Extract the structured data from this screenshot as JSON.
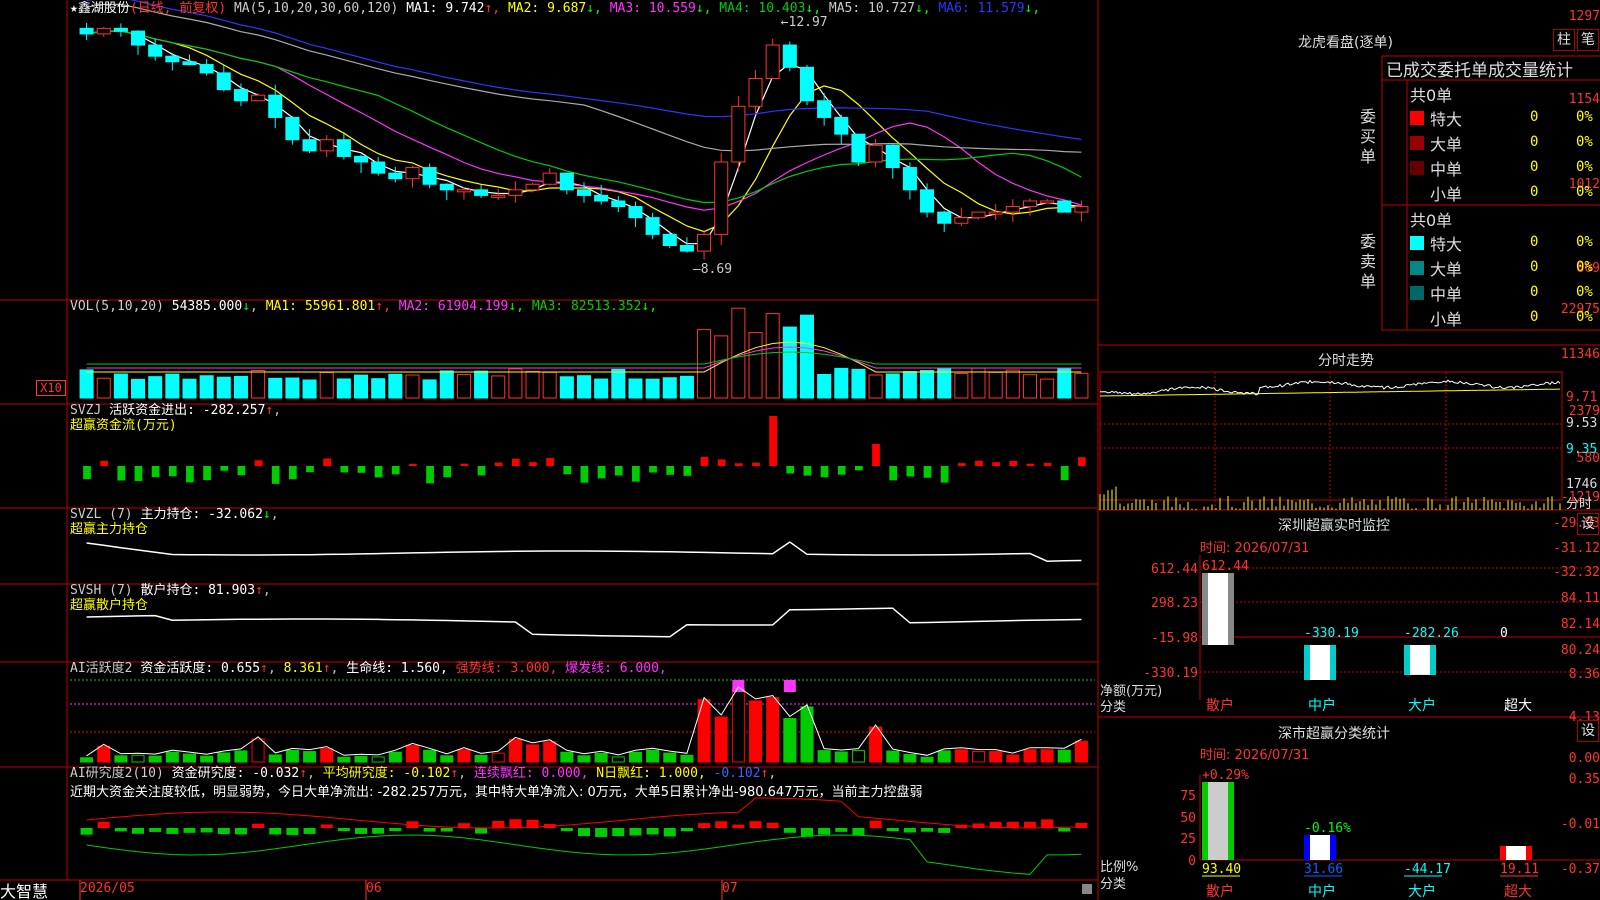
{
  "stock": {
    "name": "鑫湖股份",
    "star": "★",
    "period": "(日线, 前复权)",
    "ma_label": "MA(5,10,20,30,60,120)",
    "ma": [
      {
        "t": "MA1: 9.742",
        "a": "↑",
        "c": "#ffffff"
      },
      {
        "t": "MA2: 9.687",
        "a": "↓",
        "c": "#ffff00"
      },
      {
        "t": "MA3: 10.559",
        "a": "↓",
        "c": "#ff33ff"
      },
      {
        "t": "MA4: 10.403",
        "a": "↓",
        "c": "#00cc00"
      },
      {
        "t": "MA5: 10.727",
        "a": "↓",
        "c": "#cccccc"
      },
      {
        "t": "MA6: 11.579",
        "a": "↓",
        "c": "#3333ff"
      }
    ],
    "high_label": "12.97",
    "low_label": "8.69"
  },
  "price_axis": [
    "1297",
    "1154",
    "1012",
    "869"
  ],
  "vol": {
    "label": "VOL(5,10,20)",
    "value": "54385.000",
    "ma": [
      {
        "t": "MA1: 55961.801",
        "a": "↑",
        "c": "#ffff00"
      },
      {
        "t": "MA2: 61904.199",
        "a": "↓",
        "c": "#ff33ff"
      },
      {
        "t": "MA3: 82513.352",
        "a": "↓",
        "c": "#00cc00"
      }
    ],
    "axis": [
      "22975",
      "11346"
    ],
    "unit": "X10"
  },
  "svzj": {
    "label": "SVZJ",
    "name": "活跃资金进出: -282.257",
    "sub": "超赢资金流(万元)",
    "axis": [
      "2379",
      "580",
      "-1219"
    ]
  },
  "svzl": {
    "label": "SVZL (7)",
    "name": "主力持仓: -32.062",
    "sub": "超赢主力持仓",
    "axis": [
      "-29.93",
      "-31.12",
      "-32.32"
    ]
  },
  "svsh": {
    "label": "SVSH (7)",
    "name": "散户持仓: 81.903",
    "sub": "超赢散户持仓",
    "axis": [
      "84.11",
      "82.14",
      "80.24"
    ]
  },
  "ai1": {
    "label": "AI活跃度2",
    "a": "资金活跃度: 0.655",
    "b": "8.361",
    "c": "生命线: 1.560,",
    "d": "强势线: 3.000,",
    "e": "爆发线: 6.000,",
    "axis": [
      "8.36",
      "4.13",
      "0.00"
    ]
  },
  "ai2": {
    "label": "AI研究度2(10)",
    "a": "资金研究度: -0.032",
    "b": "平均研究度: -0.102",
    "c": "连续飘红: 0.000,",
    "d": "N日飘红: 1.000,",
    "e": "-0.102",
    "comment": "近期大资金关注度较低，明显弱势，今日大单净流出: -282.257万元，其中特大单净流入: 0万元，大单5日累计净出-980.647万元，当前主力控盘弱",
    "axis": [
      "0.35",
      "-0.01",
      "-0.37"
    ]
  },
  "date_axis": [
    "2026/05",
    "06",
    "07"
  ],
  "brand": "大智慧",
  "lhb": {
    "title": "龙虎看盘(逐单)",
    "btn1": "柱",
    "btn2": "笔",
    "tabs": [
      "已成交",
      "委托单",
      "成交量统计"
    ],
    "buy": {
      "side": "委买单",
      "total": "共0单",
      "rows": [
        {
          "n": "特大",
          "v": "0",
          "p": "0%",
          "c": "#ff0000"
        },
        {
          "n": "大单",
          "v": "0",
          "p": "0%",
          "c": "#990000"
        },
        {
          "n": "中单",
          "v": "0",
          "p": "0%",
          "c": "#660000"
        },
        {
          "n": "小单",
          "v": "0",
          "p": "0%",
          "c": "#000000"
        }
      ]
    },
    "sell": {
      "side": "委卖单",
      "total": "共0单",
      "rows": [
        {
          "n": "特大",
          "v": "0",
          "p": "0%",
          "c": "#00ffff"
        },
        {
          "n": "大单",
          "v": "0",
          "p": "0%",
          "c": "#008888"
        },
        {
          "n": "中单",
          "v": "0",
          "p": "0%",
          "c": "#006666"
        },
        {
          "n": "小单",
          "v": "0",
          "p": "0%",
          "c": "#000000"
        }
      ]
    }
  },
  "fenshi": {
    "title": "分时走势",
    "axis": [
      "9.71",
      "9.53",
      "9.35"
    ],
    "vol_axis": [
      "1746",
      "分时"
    ]
  },
  "sz_monitor": {
    "title": "深圳超赢实时监控",
    "btn": "设",
    "time": "时间: 2026/07/31",
    "axis": [
      "612.44",
      "298.23",
      "-15.98",
      "-330.19"
    ],
    "ylabel": "净额(万元)",
    "xlabel": "分类",
    "cats": [
      "散户",
      "中户",
      "大户",
      "超大"
    ],
    "vals": [
      "612.44",
      "-330.19",
      "-282.26",
      "0"
    ]
  },
  "sz_class": {
    "title": "深市超赢分类统计",
    "btn": "设",
    "time": "时间: 2026/07/31",
    "axis": [
      "75",
      "50",
      "25",
      "0"
    ],
    "ylabel": "比例%",
    "xlabel": "分类",
    "cats": [
      "散户",
      "中户",
      "大户",
      "超大"
    ],
    "top": [
      "+0.29%",
      "-0.16%",
      "",
      ""
    ],
    "vals": [
      "93.40",
      "31.66",
      "-44.17",
      "19.11"
    ]
  },
  "chart_data": [
    {
      "type": "candlestick",
      "title": "鑫湖股份 日线",
      "ylim": [
        8.69,
        12.97
      ],
      "note": "K-line with MA lines"
    },
    {
      "type": "bar",
      "title": "深圳超赢实时监控",
      "categories": [
        "散户",
        "中户",
        "大户",
        "超大"
      ],
      "values": [
        612.44,
        -330.19,
        -282.26,
        0
      ],
      "ylabel": "净额(万元)"
    },
    {
      "type": "bar",
      "title": "深市超赢分类统计",
      "categories": [
        "散户",
        "中户",
        "大户",
        "超大"
      ],
      "values": [
        93.4,
        31.66,
        -44.17,
        19.11
      ],
      "ylabel": "比例%"
    }
  ]
}
